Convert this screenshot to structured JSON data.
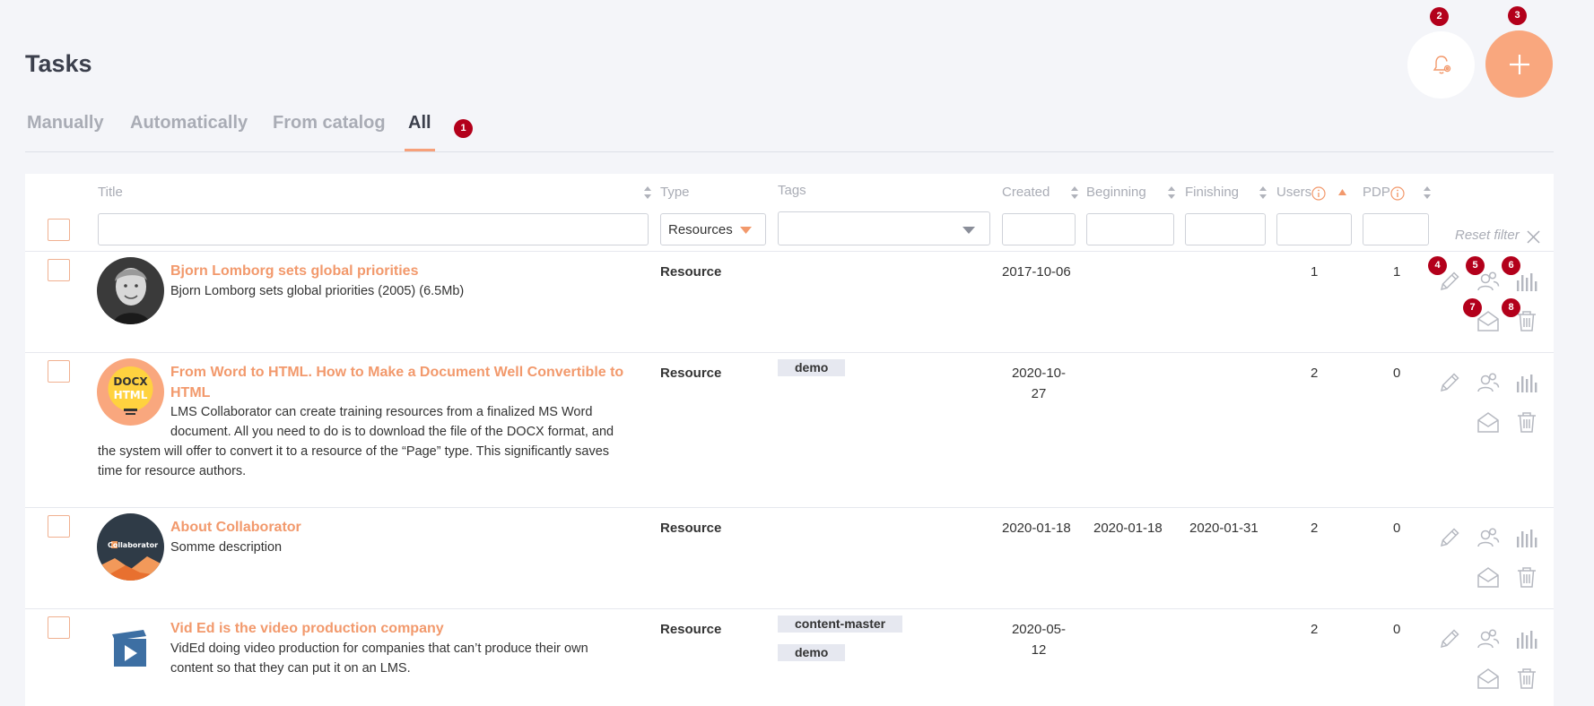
{
  "page": {
    "title": "Tasks"
  },
  "tabs": [
    {
      "label": "Manually"
    },
    {
      "label": "Automatically"
    },
    {
      "label": "From catalog"
    },
    {
      "label": "All"
    }
  ],
  "markers": [
    "1",
    "2",
    "3",
    "4",
    "5",
    "6",
    "7",
    "8"
  ],
  "colors": {
    "accent": "#f2996c",
    "add_button": "#f9a77e",
    "marker": "#b3001b",
    "icon_gray": "#a9acb5"
  },
  "columns": {
    "title": "Title",
    "type": "Type",
    "tags": "Tags",
    "created": "Created",
    "beginning": "Beginning",
    "finishing": "Finishing",
    "users": "Users",
    "pdp": "PDP"
  },
  "filters": {
    "type_selected": "Resources",
    "tags_selected": "",
    "reset_label": "Reset filter"
  },
  "rows": [
    {
      "title": "Bjorn Lomborg sets global priorities",
      "description": "Bjorn Lomborg sets global priorities (2005) (6.5Mb)",
      "type": "Resource",
      "tags": [],
      "created": "2017-10-06",
      "beginning": "",
      "finishing": "",
      "users": "1",
      "pdp": "1"
    },
    {
      "title_line1": "From Word to HTML. How to Make a Document Well Convertible to",
      "title_line2": "HTML",
      "thumb_top": "DOCX",
      "thumb_bottom": "HTML",
      "desc_line1": "LMS Collaborator can create training resources from a finalized MS Word",
      "desc_line2": "document. All you need to do is to download the file of the DOCX format, and",
      "desc_line3": "the system will offer to convert it to a resource of the “Page” type. This significantly saves",
      "desc_line4": "time for resource authors.",
      "type": "Resource",
      "tags": [
        "demo"
      ],
      "created_line1": "2020-10-",
      "created_line2": "27",
      "beginning": "",
      "finishing": "",
      "users": "2",
      "pdp": "0"
    },
    {
      "title": "About Collaborator",
      "thumb_logo": "Collaborator",
      "description": "Somme description",
      "type": "Resource",
      "tags": [],
      "created": "2020-01-18",
      "beginning": "2020-01-18",
      "finishing": "2020-01-31",
      "users": "2",
      "pdp": "0"
    },
    {
      "title": "Vid Ed is the video production company",
      "desc_line1": "VidEd doing video production for companies that can’t produce their own",
      "desc_line2": "content so that they can put it on an LMS.",
      "type": "Resource",
      "tags": [
        "content-master",
        "demo"
      ],
      "created_line1": "2020-05-",
      "created_line2": "12",
      "beginning": "",
      "finishing": "",
      "users": "2",
      "pdp": "0"
    }
  ]
}
